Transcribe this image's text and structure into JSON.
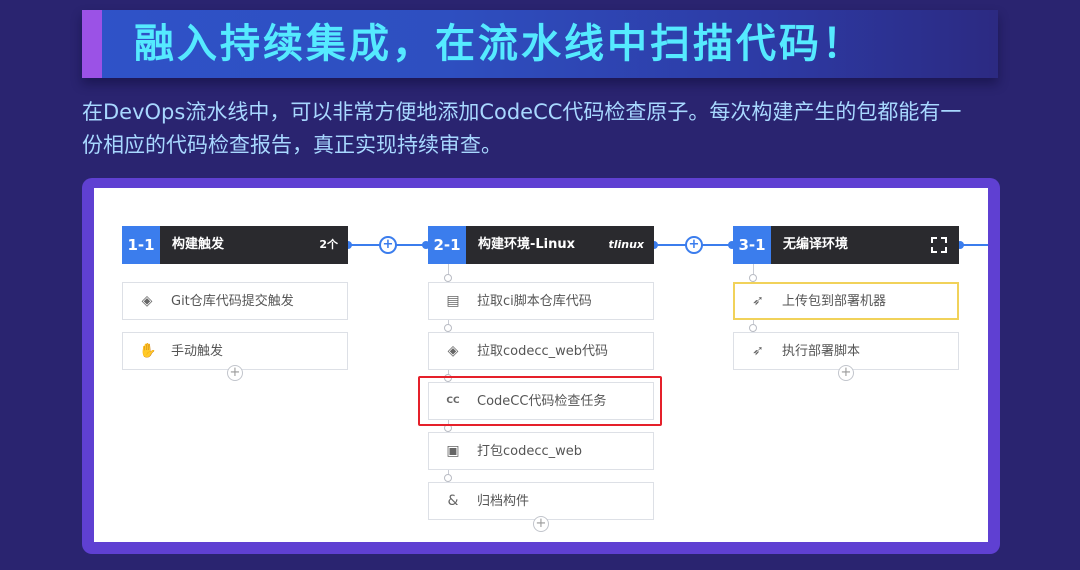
{
  "banner": {
    "title": "融入持续集成，在流水线中扫描代码！"
  },
  "description": {
    "line1": "在DevOps流水线中，可以非常方便地添加CodeCC代码检查原子。每次构建产生的包都能有一",
    "line2": "份相应的代码检查报告，真正实现持续审查。"
  },
  "colors": {
    "background": "#2a2470",
    "title_text": "#55eaff",
    "description_text": "#a8d8ff",
    "frame": "#5f40d2",
    "stage_number_bg": "#3b7ded",
    "stage_header_bg": "#2a2a2e",
    "highlight": "#e5202a",
    "pending_border": "#f1d25a"
  },
  "pipeline": {
    "stages": [
      {
        "number": "1-1",
        "title": "构建触发",
        "badge": "2个",
        "jobs": [
          {
            "icon": "git-icon",
            "label": "Git仓库代码提交触发"
          },
          {
            "icon": "hand-icon",
            "label": "手动触发"
          }
        ]
      },
      {
        "number": "2-1",
        "title": "构建环境-Linux",
        "badge": "tlinux",
        "jobs": [
          {
            "icon": "terminal-icon",
            "label": "拉取ci脚本仓库代码"
          },
          {
            "icon": "git-icon",
            "label": "拉取codecc_web代码"
          },
          {
            "icon": "codecc-icon",
            "label": "CodeCC代码检查任务"
          },
          {
            "icon": "script-icon",
            "label": "打包codecc_web"
          },
          {
            "icon": "archive-icon",
            "label": "归档构件"
          }
        ]
      },
      {
        "number": "3-1",
        "title": "无编译环境",
        "badge_icon": "select-box-icon",
        "jobs": [
          {
            "icon": "rocket-icon",
            "label": "上传包到部署机器"
          },
          {
            "icon": "rocket-icon",
            "label": "执行部署脚本"
          }
        ]
      }
    ]
  }
}
